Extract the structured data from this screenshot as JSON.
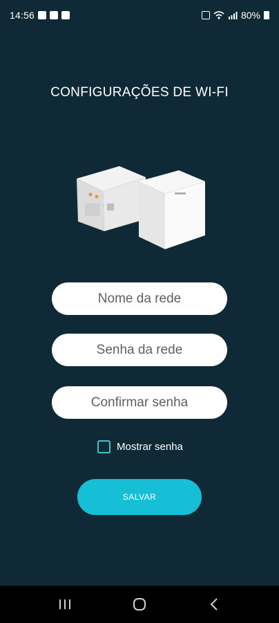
{
  "status_bar": {
    "time": "14:56",
    "battery": "80%"
  },
  "title": "CONFIGURAÇÕES DE WI-FI",
  "form": {
    "network_name_placeholder": "Nome da rede",
    "network_password_placeholder": "Senha da rede",
    "confirm_password_placeholder": "Confirmar senha",
    "show_password_label": "Mostrar senha",
    "show_password_checked": false,
    "save_label": "SALVAR"
  },
  "colors": {
    "background": "#0f2a36",
    "accent": "#16bfd6"
  },
  "nav_bar": {
    "icons": [
      "recent-apps-icon",
      "home-icon",
      "back-icon"
    ]
  }
}
